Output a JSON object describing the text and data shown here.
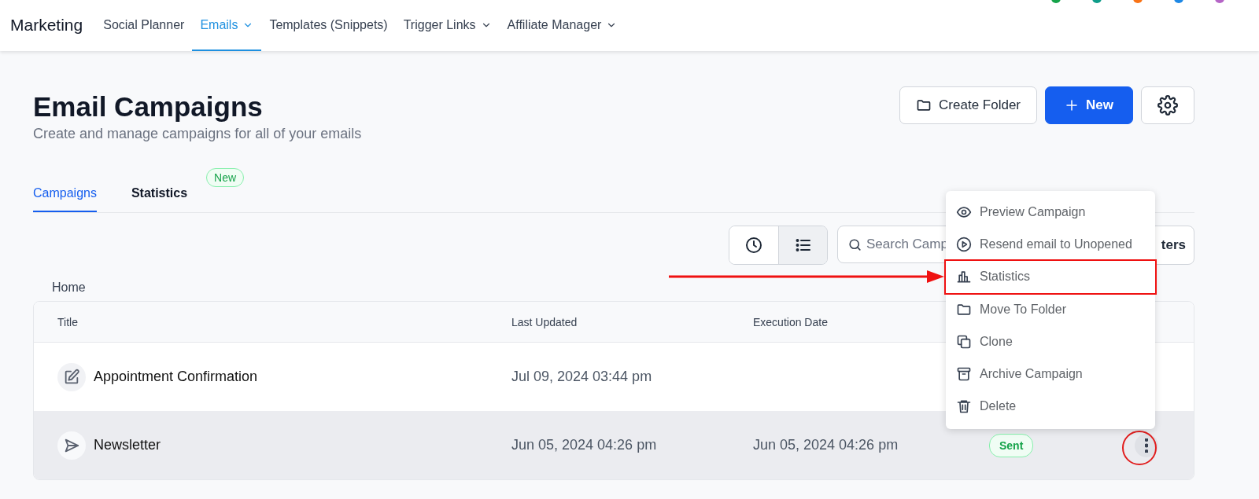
{
  "top_nav": {
    "app_title": "Marketing",
    "items": [
      {
        "label": "Social Planner",
        "selected": false,
        "dropdown": false
      },
      {
        "label": "Emails",
        "selected": true,
        "dropdown": true
      },
      {
        "label": "Templates (Snippets)",
        "selected": false,
        "dropdown": false
      },
      {
        "label": "Trigger Links",
        "selected": false,
        "dropdown": true
      },
      {
        "label": "Affiliate Manager",
        "selected": false,
        "dropdown": true
      }
    ]
  },
  "page": {
    "title": "Email Campaigns",
    "subtitle": "Create and manage campaigns for all of your emails"
  },
  "actions": [
    {
      "kind": "folder",
      "label": "Create Folder"
    },
    {
      "kind": "new",
      "label": "New"
    },
    {
      "kind": "settings"
    }
  ],
  "tabs": [
    {
      "label": "Campaigns",
      "selected": true
    },
    {
      "label": "Statistics",
      "selected": false,
      "badge": "New"
    }
  ],
  "toolbar": {
    "views": [
      {
        "kind": "clock",
        "selected": false
      },
      {
        "kind": "list",
        "selected": true
      }
    ],
    "search": {
      "placeholder": "Search Camp"
    },
    "filters_label": "ters"
  },
  "breadcrumb": "Home",
  "table": {
    "columns": [
      "Title",
      "Last Updated",
      "Execution Date"
    ],
    "rows": [
      {
        "kind": "draft",
        "title": "Appointment Confirmation",
        "last_updated": "Jul 09, 2024 03:44 pm",
        "selected": false,
        "menu_button": false
      },
      {
        "kind": "sent",
        "title": "Newsletter",
        "last_updated": "Jun 05, 2024 04:26 pm",
        "execution_date": "Jun 05, 2024 04:26 pm",
        "status": "Sent",
        "selected": true,
        "menu_button": true,
        "circled": true
      }
    ]
  },
  "context_menu": {
    "items": [
      {
        "kind": "eye",
        "label": "Preview Campaign",
        "highlighted": false
      },
      {
        "kind": "play",
        "label": "Resend email to Unopened",
        "highlighted": false
      },
      {
        "kind": "chart",
        "label": "Statistics",
        "highlighted": true
      },
      {
        "kind": "folder",
        "label": "Move To Folder",
        "highlighted": false
      },
      {
        "kind": "copy",
        "label": "Clone",
        "highlighted": false
      },
      {
        "kind": "archive",
        "label": "Archive Campaign",
        "highlighted": false
      },
      {
        "kind": "trash",
        "label": "Delete",
        "highlighted": false
      }
    ]
  }
}
